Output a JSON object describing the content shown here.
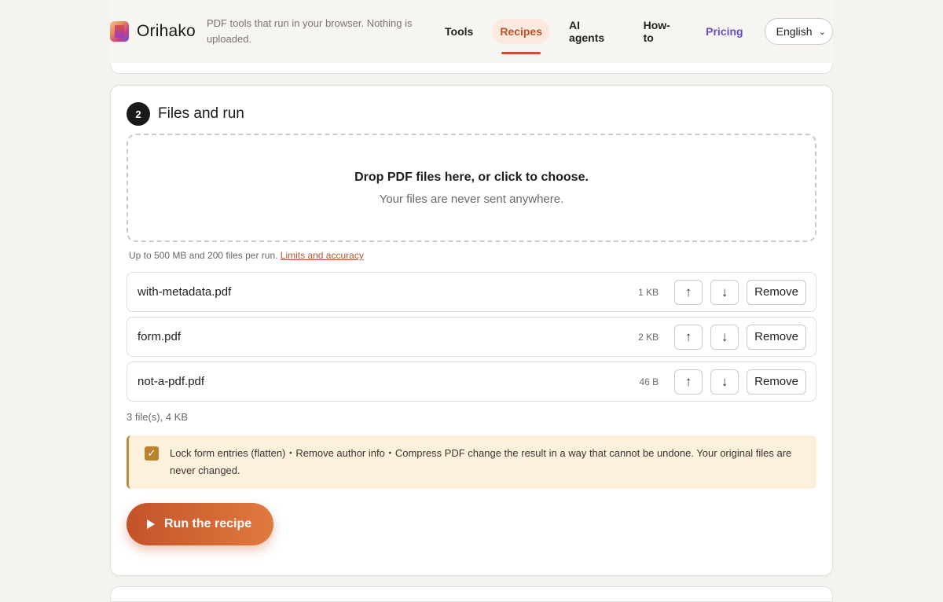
{
  "header": {
    "brand": "Orihako",
    "tagline": "PDF tools that run in your browser. Nothing is uploaded.",
    "nav": [
      {
        "label": "Tools"
      },
      {
        "label": "Recipes"
      },
      {
        "label": "AI agents"
      },
      {
        "label": "How-to"
      },
      {
        "label": "Pricing"
      }
    ],
    "active_nav": "Recipes",
    "language": "English"
  },
  "step": {
    "number": "2",
    "title": "Files and run"
  },
  "dropzone": {
    "main": "Drop PDF files here, or click to choose.",
    "sub": "Your files are never sent anywhere."
  },
  "limits": {
    "text": "Up to 500 MB and 200 files per run. ",
    "link": "Limits and accuracy"
  },
  "files": [
    {
      "name": "with-metadata.pdf",
      "size": "1 KB"
    },
    {
      "name": "form.pdf",
      "size": "2 KB"
    },
    {
      "name": "not-a-pdf.pdf",
      "size": "46 B"
    }
  ],
  "file_actions": {
    "up": "↑",
    "down": "↓",
    "remove": "Remove"
  },
  "summary": "3 file(s), 4 KB",
  "warning": {
    "checked": true,
    "text": "Lock form entries (flatten)・Remove author info・Compress PDF change the result in a way that cannot be undone. Your original files are never changed."
  },
  "run_button": "Run the recipe",
  "colors": {
    "accent": "#c8512d",
    "pricing": "#6a4bc8",
    "warning_bg": "#fdf1de"
  }
}
